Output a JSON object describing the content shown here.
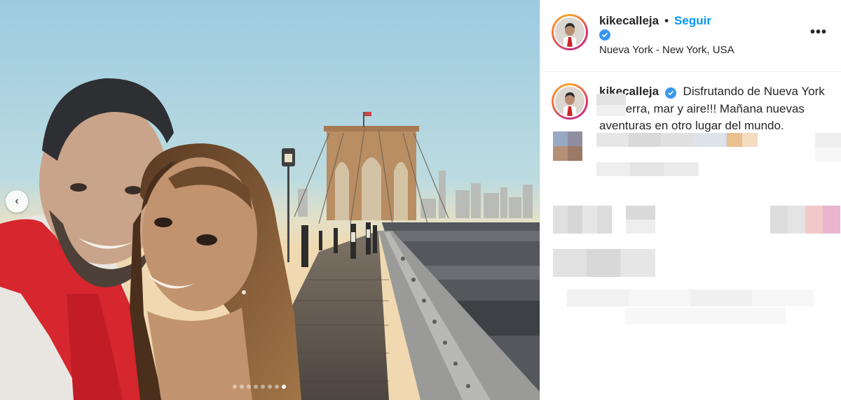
{
  "photo": {
    "prev_icon": "chevron-left-icon",
    "carousel_dots": 8,
    "active_dot": 7
  },
  "header": {
    "username": "kikecalleja",
    "separator": "•",
    "follow_label": "Seguir",
    "verified_icon": "verified-badge-icon",
    "location": "Nueva York - New York, USA",
    "more_icon": "more-options-icon",
    "more_label": "•••"
  },
  "caption": {
    "username": "kikecalleja",
    "text": "Disfrutando de Nueva York por tierra, mar y aire!!! Mañana nuevas aventuras en otro lugar del mundo."
  },
  "colors": {
    "accent": "#0095f6",
    "verified": "#3897f0",
    "text": "#262626",
    "border": "#efefef"
  }
}
